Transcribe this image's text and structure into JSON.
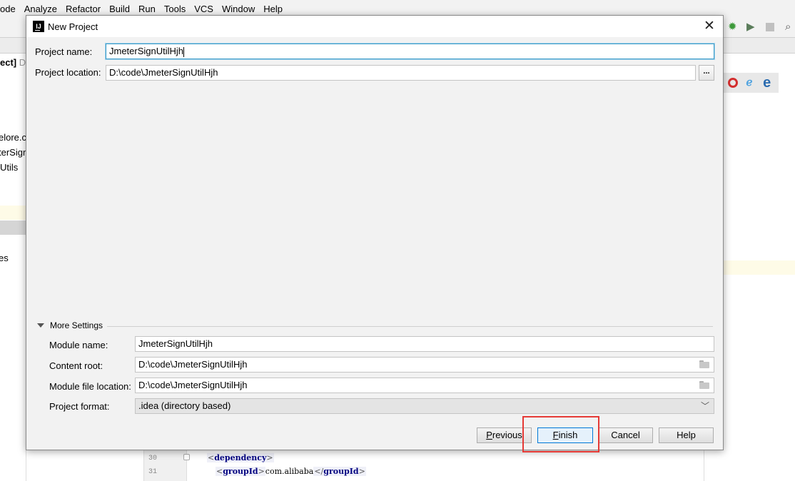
{
  "ide": {
    "menu": [
      "ode",
      "Analyze",
      "Refactor",
      "Build",
      "Run",
      "Tools",
      "VCS",
      "Window",
      "Help"
    ],
    "toolbar_icons": [
      "debug-icon",
      "coverage-icon",
      "stop-icon",
      "search-icon"
    ],
    "project_panel": {
      "items": [
        {
          "text": "ect]",
          "suffix": "D",
          "icon": "project-root"
        },
        {
          "text": "elore.c"
        },
        {
          "text": "terSign"
        },
        {
          "text": "Utils"
        },
        {
          "text": "es"
        }
      ]
    },
    "browser_icons": [
      "opera-icon",
      "ie-icon",
      "edge-icon"
    ],
    "code": {
      "lines": [
        {
          "number": "30",
          "open_br": "<",
          "tag": "dependency",
          "close_br": ">"
        },
        {
          "number": "31",
          "open_br": "<",
          "tag": "groupId",
          "close_br": ">",
          "value": "com.alibaba",
          "end_open": "</",
          "end_tag": "groupId",
          "end_close": ">"
        }
      ]
    }
  },
  "dialog": {
    "app_icon_text": "IJ",
    "title": "New Project",
    "close_label": "✕",
    "project_name_label": "Project name:",
    "project_name_value": "JmeterSignUtilHjh",
    "project_location_label": "Project location:",
    "project_location_value": "D:\\code\\JmeterSignUtilHjh",
    "browse_label": "...",
    "more_settings_label": "More Settings",
    "module_name_label": "Module name:",
    "module_name_value": "JmeterSignUtilHjh",
    "content_root_label": "Content root:",
    "content_root_value": "D:\\code\\JmeterSignUtilHjh",
    "module_file_location_label": "Module file location:",
    "module_file_location_value": "D:\\code\\JmeterSignUtilHjh",
    "project_format_label": "Project format:",
    "project_format_value": ".idea (directory based)",
    "buttons": {
      "previous": {
        "mnemonic": "P",
        "rest": "revious"
      },
      "finish": {
        "mnemonic": "F",
        "rest": "inish"
      },
      "cancel": "Cancel",
      "help": "Help"
    }
  },
  "colors": {
    "focus_border": "#3c9bc7",
    "default_button_border": "#0078d7",
    "annotation_red": "#e53935"
  }
}
